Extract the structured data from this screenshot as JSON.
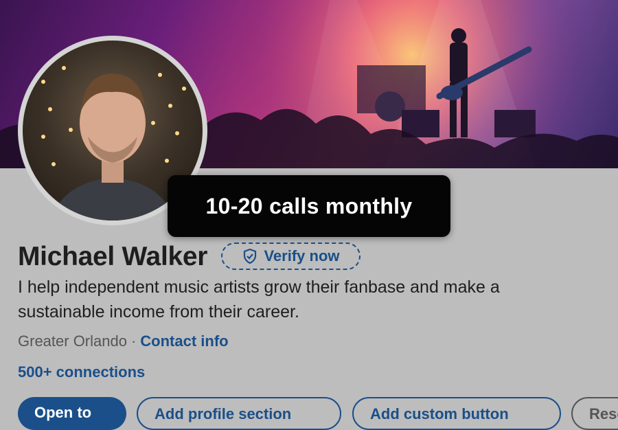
{
  "profile": {
    "name": "Michael Walker",
    "verify_label": "Verify now",
    "headline": "I help independent music artists grow their fanbase and make a sustainable income from their career.",
    "location": "Greater Orlando",
    "separator": "·",
    "contact_label": "Contact info",
    "connections": "500+ connections"
  },
  "tooltip": {
    "text": "10-20 calls monthly"
  },
  "actions": {
    "open_to_label": "Open to",
    "add_section_label": "Add profile section",
    "add_button_label": "Add custom button",
    "more_label": "Resources"
  },
  "colors": {
    "brand": "#1a4f8a",
    "overlay": "#050505"
  }
}
